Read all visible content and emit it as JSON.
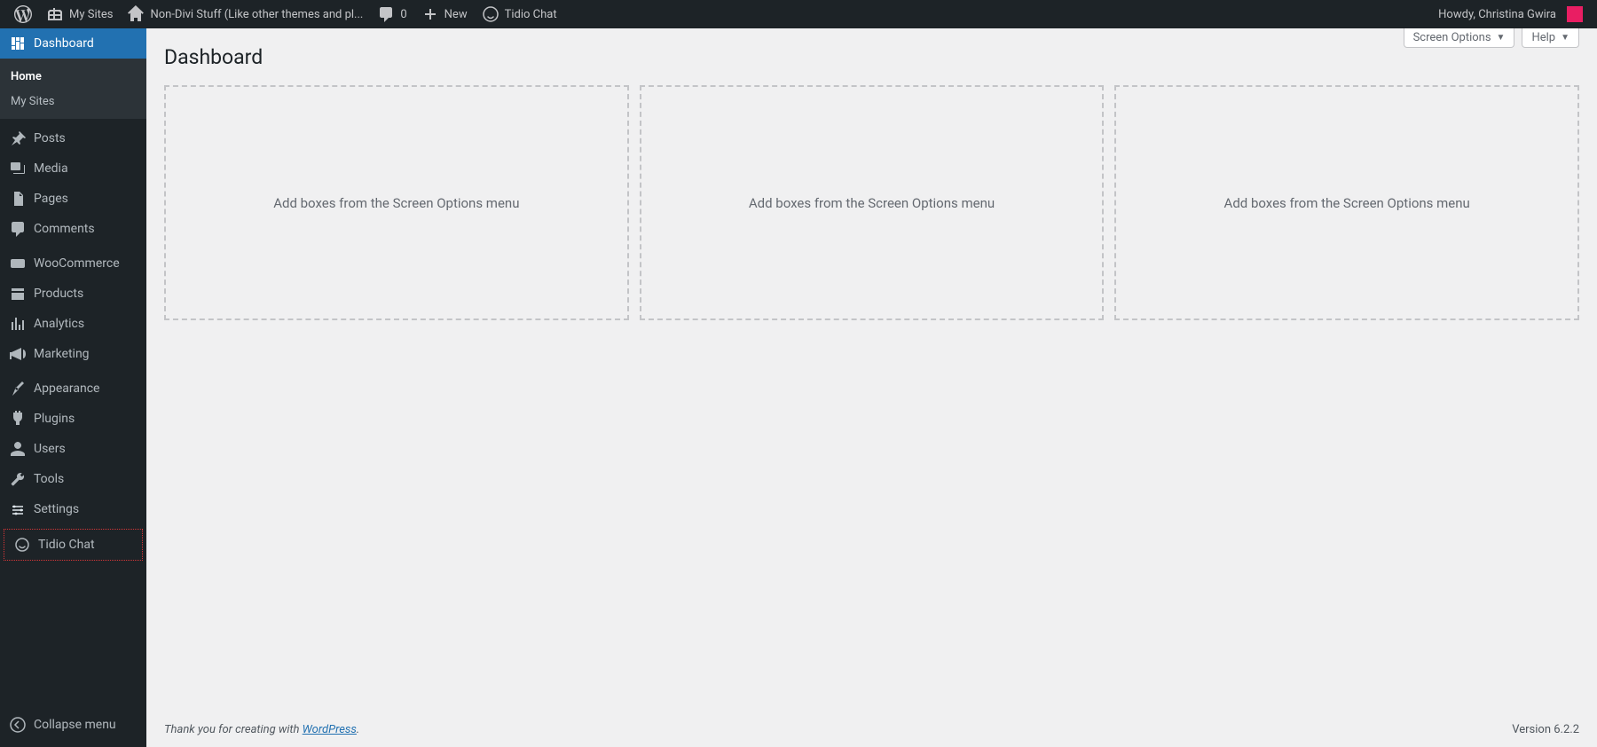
{
  "adminbar": {
    "my_sites": "My Sites",
    "site_name": "Non-Divi Stuff (Like other themes and pl...",
    "comments_count": "0",
    "new_label": "New",
    "tidio_label": "Tidio Chat",
    "howdy": "Howdy, Christina Gwira"
  },
  "sidebar": {
    "dashboard": "Dashboard",
    "submenu": {
      "home": "Home",
      "my_sites": "My Sites"
    },
    "posts": "Posts",
    "media": "Media",
    "pages": "Pages",
    "comments": "Comments",
    "woocommerce": "WooCommerce",
    "products": "Products",
    "analytics": "Analytics",
    "marketing": "Marketing",
    "appearance": "Appearance",
    "plugins": "Plugins",
    "users": "Users",
    "tools": "Tools",
    "settings": "Settings",
    "tidio": "Tidio Chat",
    "collapse": "Collapse menu"
  },
  "page": {
    "title": "Dashboard",
    "screen_options": "Screen Options",
    "help": "Help",
    "box_placeholder": "Add boxes from the Screen Options menu"
  },
  "footer": {
    "thanks_prefix": "Thank you for creating with ",
    "wp_link": "WordPress",
    "period": ".",
    "version": "Version 6.2.2"
  }
}
